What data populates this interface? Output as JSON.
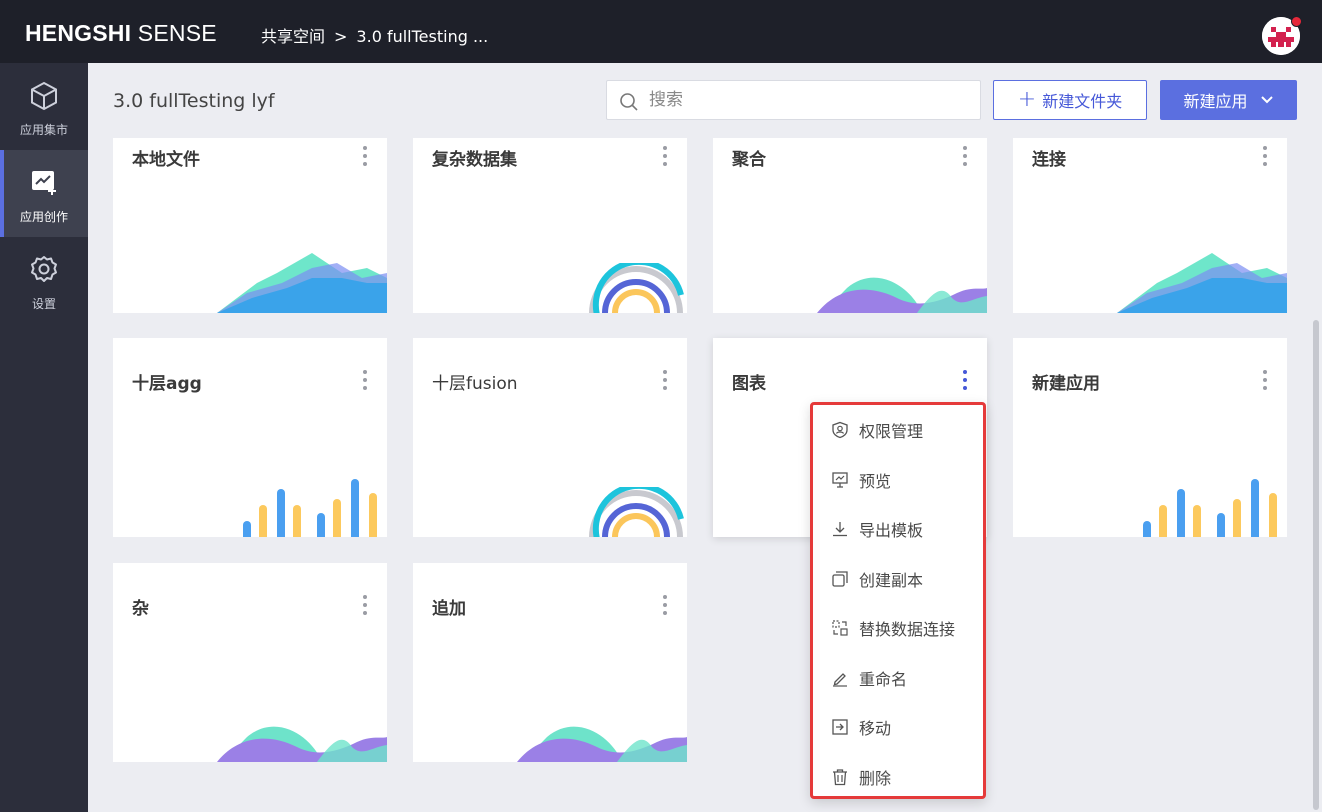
{
  "topbar": {
    "logo_bold": "HENGSHI",
    "logo_light": "SENSE",
    "crumb_root": "共享空间",
    "crumb_sep": ">",
    "crumb_current": "3.0 fullTesting ..."
  },
  "sidebar": {
    "items": [
      {
        "label": "应用集市",
        "icon": "cube-icon"
      },
      {
        "label": "应用创作",
        "icon": "chart-create-icon"
      },
      {
        "label": "设置",
        "icon": "gear-icon"
      }
    ]
  },
  "main": {
    "folder_title": "3.0 fullTesting lyf",
    "search_placeholder": "搜索",
    "new_folder_label": "新建文件夹",
    "new_app_label": "新建应用"
  },
  "cards": [
    {
      "title": "本地文件",
      "thumb": "mountain"
    },
    {
      "title": "复杂数据集",
      "thumb": "rings"
    },
    {
      "title": "聚合",
      "thumb": "wave"
    },
    {
      "title": "连接",
      "thumb": "mountain"
    },
    {
      "title": "十层agg",
      "thumb": "bars"
    },
    {
      "title": "十层fusion",
      "thumb": "rings"
    },
    {
      "title": "图表",
      "thumb": "none"
    },
    {
      "title": "新建应用",
      "thumb": "bars"
    },
    {
      "title": "杂",
      "thumb": "wave"
    },
    {
      "title": "追加",
      "thumb": "wave"
    }
  ],
  "context_menu": {
    "items": [
      {
        "label": "权限管理",
        "icon": "shield-user-icon"
      },
      {
        "label": "预览",
        "icon": "preview-icon"
      },
      {
        "label": "导出模板",
        "icon": "download-icon"
      },
      {
        "label": "创建副本",
        "icon": "copy-icon"
      },
      {
        "label": "替换数据连接",
        "icon": "swap-connection-icon"
      },
      {
        "label": "重命名",
        "icon": "pencil-icon"
      },
      {
        "label": "移动",
        "icon": "move-icon"
      },
      {
        "label": "删除",
        "icon": "trash-icon"
      }
    ]
  },
  "colors": {
    "accent": "#5b6fe0",
    "topbar": "#1e2029",
    "sidebar": "#2c2e3b",
    "menu_highlight": "#e53a3a"
  }
}
